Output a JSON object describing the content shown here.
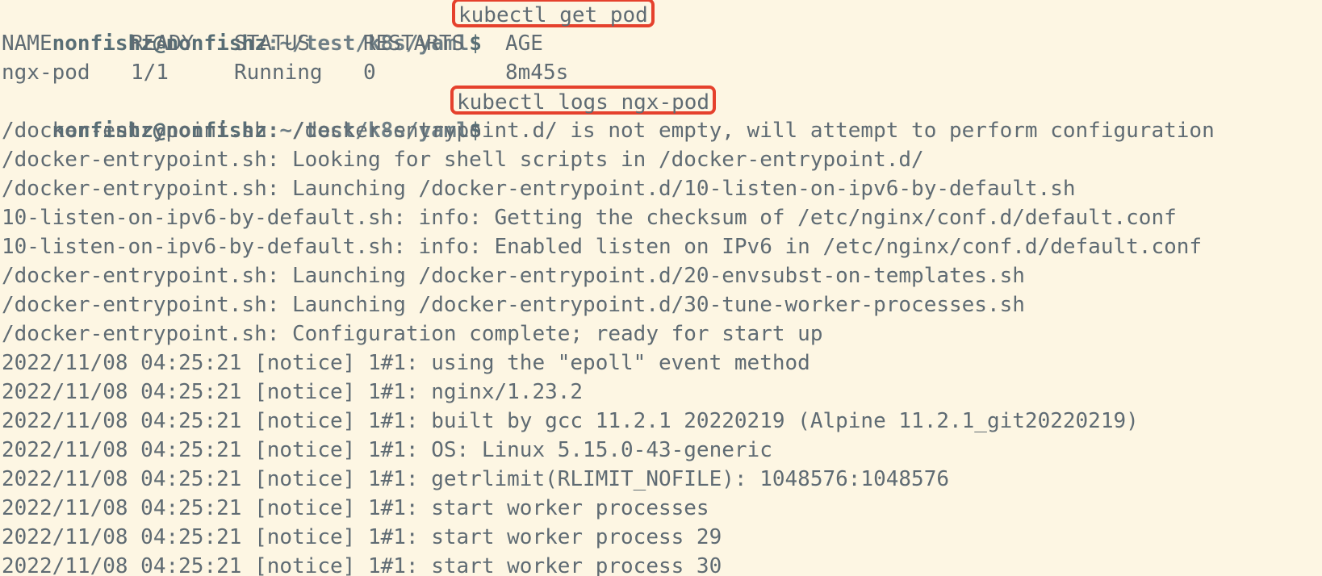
{
  "prompt": {
    "user_host": "nonfishz@nonfishz",
    "path": ":~/test/k8s/yaml",
    "symbol": "$"
  },
  "commands": [
    "kubectl get pod",
    "kubectl logs ngx-pod"
  ],
  "pod_table": {
    "headers": [
      "NAME",
      "READY",
      "STATUS",
      "RESTARTS",
      "AGE"
    ],
    "rows": [
      [
        "ngx-pod",
        "1/1",
        "Running",
        "0",
        "8m45s"
      ]
    ]
  },
  "log_lines": [
    "/docker-entrypoint.sh: /docker-entrypoint.d/ is not empty, will attempt to perform configuration",
    "/docker-entrypoint.sh: Looking for shell scripts in /docker-entrypoint.d/",
    "/docker-entrypoint.sh: Launching /docker-entrypoint.d/10-listen-on-ipv6-by-default.sh",
    "10-listen-on-ipv6-by-default.sh: info: Getting the checksum of /etc/nginx/conf.d/default.conf",
    "10-listen-on-ipv6-by-default.sh: info: Enabled listen on IPv6 in /etc/nginx/conf.d/default.conf",
    "/docker-entrypoint.sh: Launching /docker-entrypoint.d/20-envsubst-on-templates.sh",
    "/docker-entrypoint.sh: Launching /docker-entrypoint.d/30-tune-worker-processes.sh",
    "/docker-entrypoint.sh: Configuration complete; ready for start up",
    "2022/11/08 04:25:21 [notice] 1#1: using the \"epoll\" event method",
    "2022/11/08 04:25:21 [notice] 1#1: nginx/1.23.2",
    "2022/11/08 04:25:21 [notice] 1#1: built by gcc 11.2.1 20220219 (Alpine 11.2.1_git20220219)",
    "2022/11/08 04:25:21 [notice] 1#1: OS: Linux 5.15.0-43-generic",
    "2022/11/08 04:25:21 [notice] 1#1: getrlimit(RLIMIT_NOFILE): 1048576:1048576",
    "2022/11/08 04:25:21 [notice] 1#1: start worker processes",
    "2022/11/08 04:25:21 [notice] 1#1: start worker process 29",
    "2022/11/08 04:25:21 [notice] 1#1: start worker process 30"
  ],
  "colors": {
    "background": "#fdf6e3",
    "text": "#5f6b73",
    "highlight_box": "#e5412d"
  }
}
